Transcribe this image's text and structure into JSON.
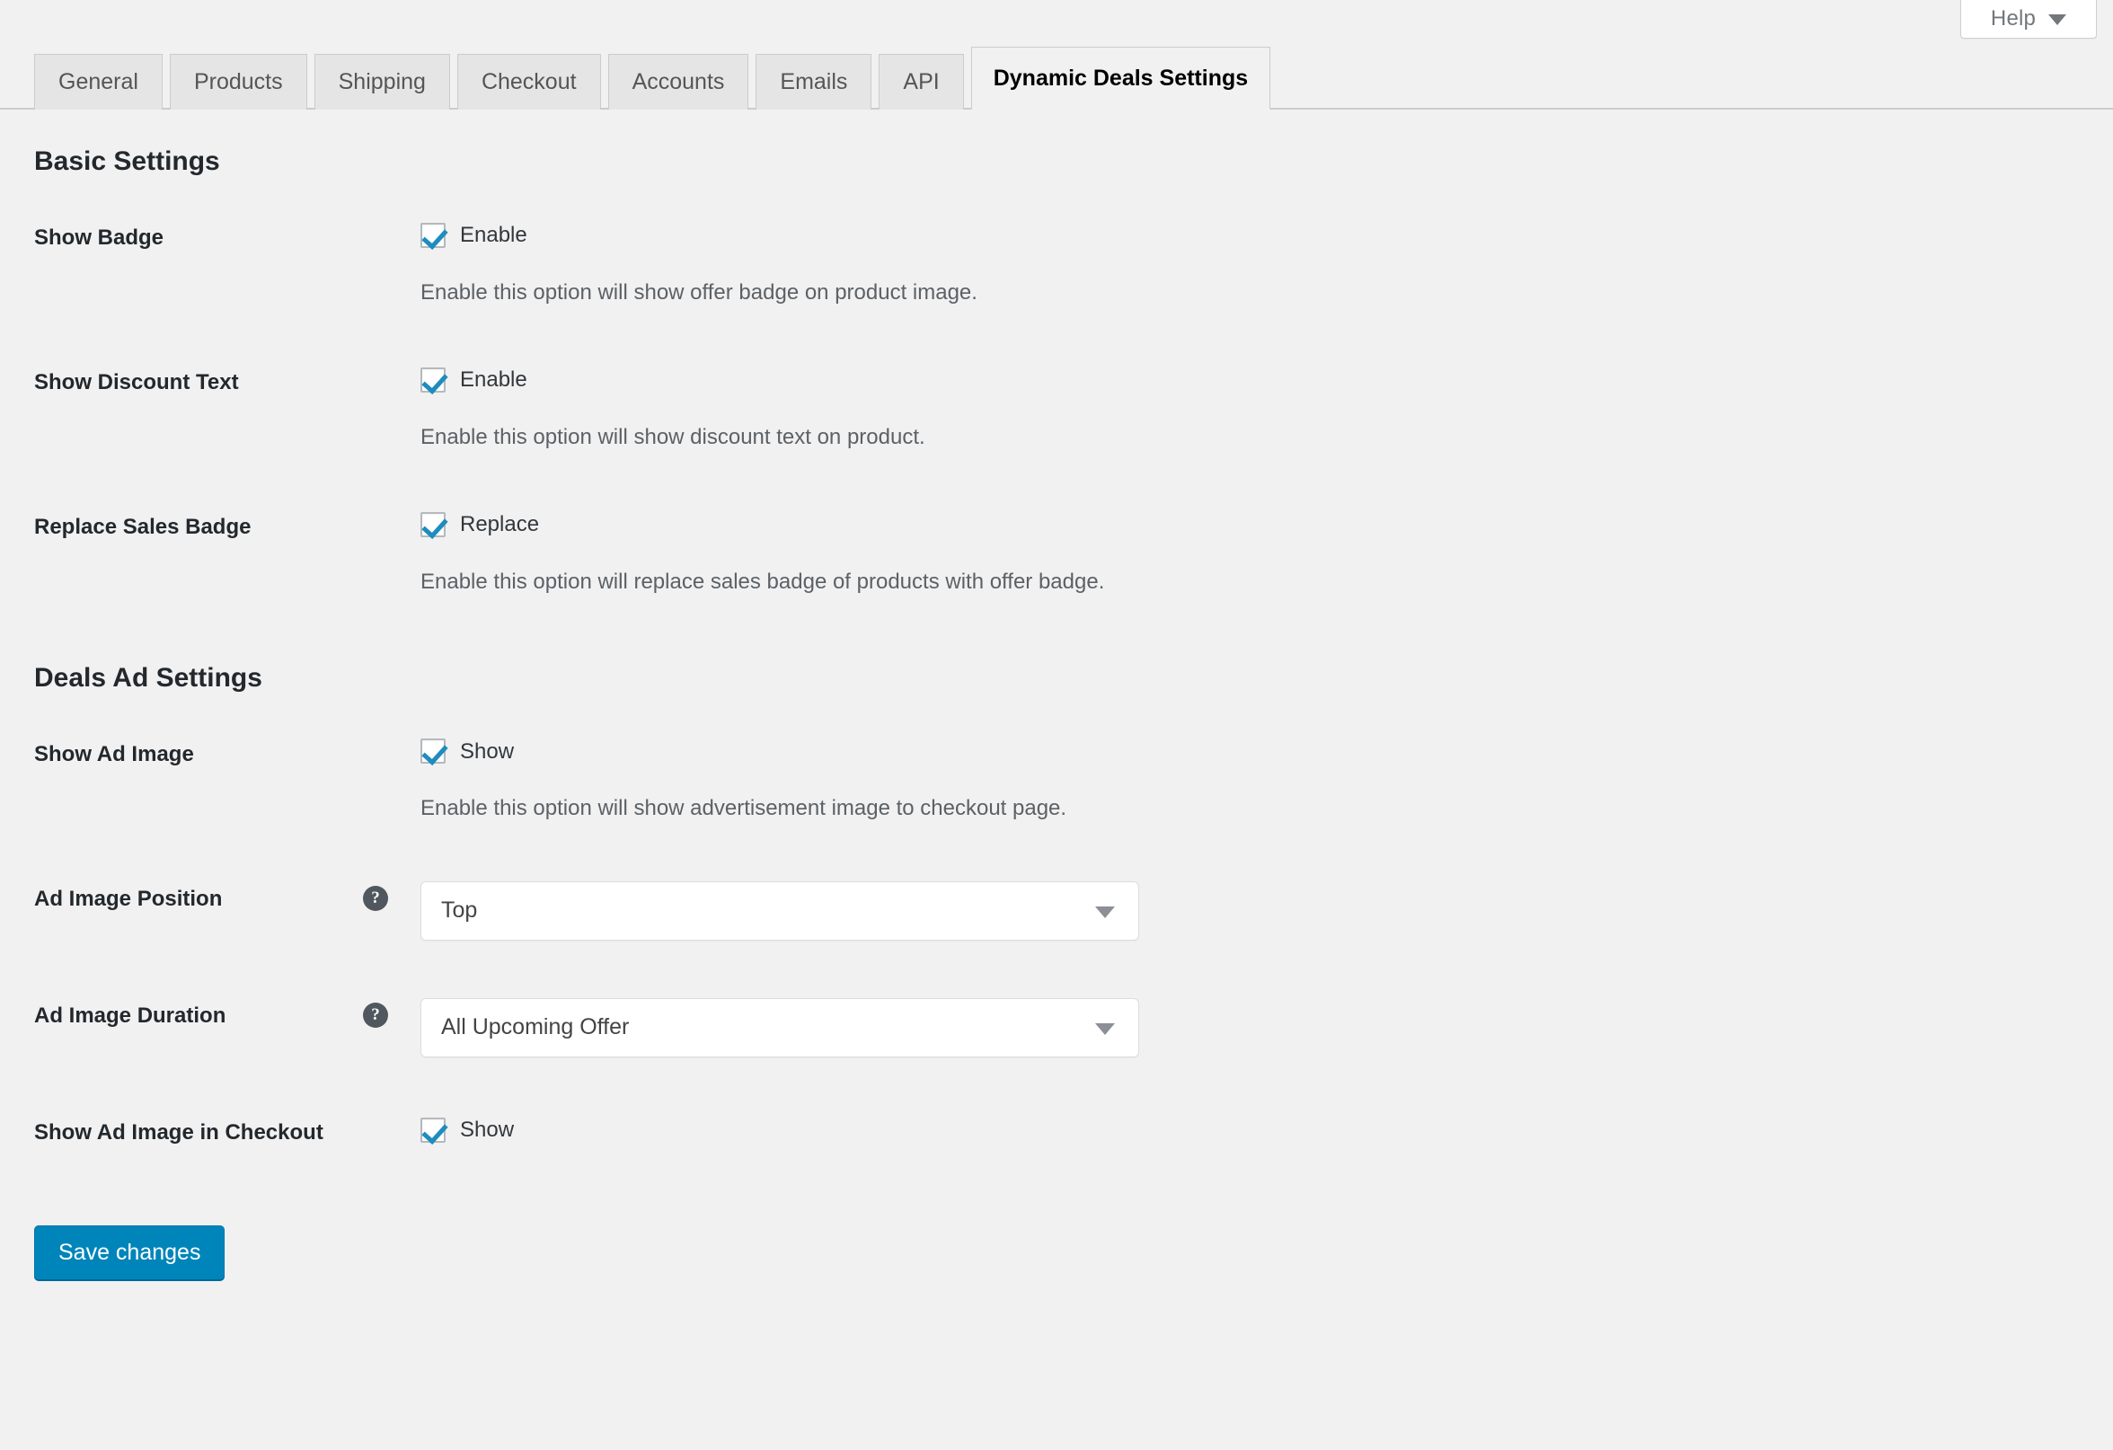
{
  "help": {
    "label": "Help",
    "caret_icon": "chevron-down-icon"
  },
  "tabs": [
    {
      "label": "General",
      "active": false
    },
    {
      "label": "Products",
      "active": false
    },
    {
      "label": "Shipping",
      "active": false
    },
    {
      "label": "Checkout",
      "active": false
    },
    {
      "label": "Accounts",
      "active": false
    },
    {
      "label": "Emails",
      "active": false
    },
    {
      "label": "API",
      "active": false
    },
    {
      "label": "Dynamic Deals Settings",
      "active": true
    }
  ],
  "sections": [
    {
      "heading": "Basic Settings",
      "rows": [
        {
          "label": "Show Badge",
          "type": "checkbox",
          "checkbox_label": "Enable",
          "checked": true,
          "description": "Enable this option will show offer badge on product image.",
          "help_tip": false
        },
        {
          "label": "Show Discount Text",
          "type": "checkbox",
          "checkbox_label": "Enable",
          "checked": true,
          "description": "Enable this option will show discount text on product.",
          "help_tip": false
        },
        {
          "label": "Replace Sales Badge",
          "type": "checkbox",
          "checkbox_label": "Replace",
          "checked": true,
          "description": "Enable this option will replace sales badge of products with offer badge.",
          "help_tip": false
        }
      ]
    },
    {
      "heading": "Deals Ad Settings",
      "rows": [
        {
          "label": "Show Ad Image",
          "type": "checkbox",
          "checkbox_label": "Show",
          "checked": true,
          "description": "Enable this option will show advertisement image to checkout page.",
          "help_tip": false
        },
        {
          "label": "Ad Image Position",
          "type": "select",
          "value": "Top",
          "description": "",
          "help_tip": true
        },
        {
          "label": "Ad Image Duration",
          "type": "select",
          "value": "All Upcoming Offer",
          "description": "",
          "help_tip": true
        },
        {
          "label": "Show Ad Image in Checkout",
          "type": "checkbox",
          "checkbox_label": "Show",
          "checked": true,
          "description": "",
          "help_tip": false
        }
      ]
    }
  ],
  "submit": {
    "save_label": "Save changes"
  },
  "icons": {
    "help_tip_glyph": "?",
    "select_arrow": "select-arrow-icon"
  },
  "colors": {
    "page_background": "#f1f1f1",
    "tab_inactive": "#e5e5e5",
    "tab_active": "#f1f1f1",
    "checkbox_check": "#1e8cbe",
    "primary_button": "#0085ba",
    "description_text": "#5c6166",
    "help_tip_background": "#50575e"
  }
}
